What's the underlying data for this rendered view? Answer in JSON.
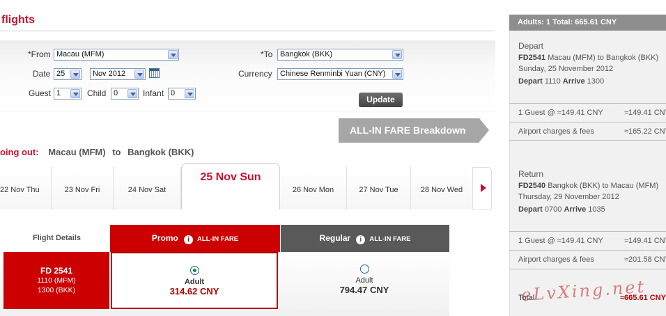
{
  "page": {
    "title": "flights"
  },
  "search": {
    "from_label": "*From",
    "from_value": "Macau (MFM)",
    "to_label": "*To",
    "to_value": "Bangkok (BKK)",
    "date_label": "Date",
    "date_day": "25",
    "date_month": "Nov 2012",
    "currency_label": "Currency",
    "currency_value": "Chinese Renminbi Yuan (CNY)",
    "guest_label": "Guest",
    "guest_value": "1",
    "child_label": "Child",
    "child_value": "0",
    "infant_label": "Infant",
    "infant_value": "0",
    "update_label": "Update"
  },
  "breakdown": {
    "label": "ALL-IN FARE Breakdown"
  },
  "going_out": {
    "label": "oing out:",
    "route_from": "Macau (MFM)",
    "to_word": "to",
    "route_to": "Bangkok (BKK)"
  },
  "date_tabs": [
    {
      "label": "22 Nov Thu"
    },
    {
      "label": "23 Nov Fri"
    },
    {
      "label": "24 Nov Sat"
    },
    {
      "label": "25 Nov Sun",
      "active": true
    },
    {
      "label": "26 Nov Mon"
    },
    {
      "label": "27 Nov Tue"
    },
    {
      "label": "28 Nov Wed"
    }
  ],
  "fare_table": {
    "details_header": "Flight Details",
    "promo_header": "Promo",
    "promo_sub": "ALL-IN FARE",
    "regular_header": "Regular",
    "regular_sub": "ALL-IN FARE",
    "info_glyph": "i",
    "flight": {
      "number": "FD  2541",
      "depart": "1110  (MFM)",
      "arrive": "1300  (BKK)"
    },
    "promo": {
      "type": "Adult",
      "price": "314.62 CNY",
      "selected": true
    },
    "regular": {
      "type": "Adult",
      "price": "794.47 CNY",
      "selected": false
    }
  },
  "summary": {
    "header": "Adults: 1  Total: 665.61 CNY",
    "depart": {
      "title": "Depart",
      "flight_no": "FD2541",
      "route": " Macau (MFM) to Bangkok (BKK)",
      "date": "Sunday, 25 November 2012",
      "depart_label": "Depart",
      "depart_time": " 1110 ",
      "arrive_label": "Arrive",
      "arrive_time": " 1300",
      "guest_line": "1 Guest @ ≈149.41 CNY",
      "guest_amount": "≈149.41 CNY",
      "fees_label": "Airport charges & fees",
      "fees_amount": "≈165.22 CNY"
    },
    "return": {
      "title": "Return",
      "flight_no": "FD2540",
      "route": " Bangkok (BKK) to Macau (MFM)",
      "date": "Thursday, 29 November 2012",
      "depart_label": "Depart",
      "depart_time": " 0700 ",
      "arrive_label": "Arrive",
      "arrive_time": " 1035",
      "guest_line": "1 Guest @ ≈149.41 CNY",
      "guest_amount": "≈149.41 CNY",
      "fees_label": "Airport charges & fees",
      "fees_amount": "≈201.58 CNY"
    },
    "total_label": "Total",
    "total_amount": "≈665.61 CNY"
  },
  "watermark": "eLvXing.net",
  "colors": {
    "brand_red": "#c8102e",
    "promo_red": "#cc0000",
    "regular_grey": "#595959",
    "summary_grey": "#8e8e8e"
  }
}
